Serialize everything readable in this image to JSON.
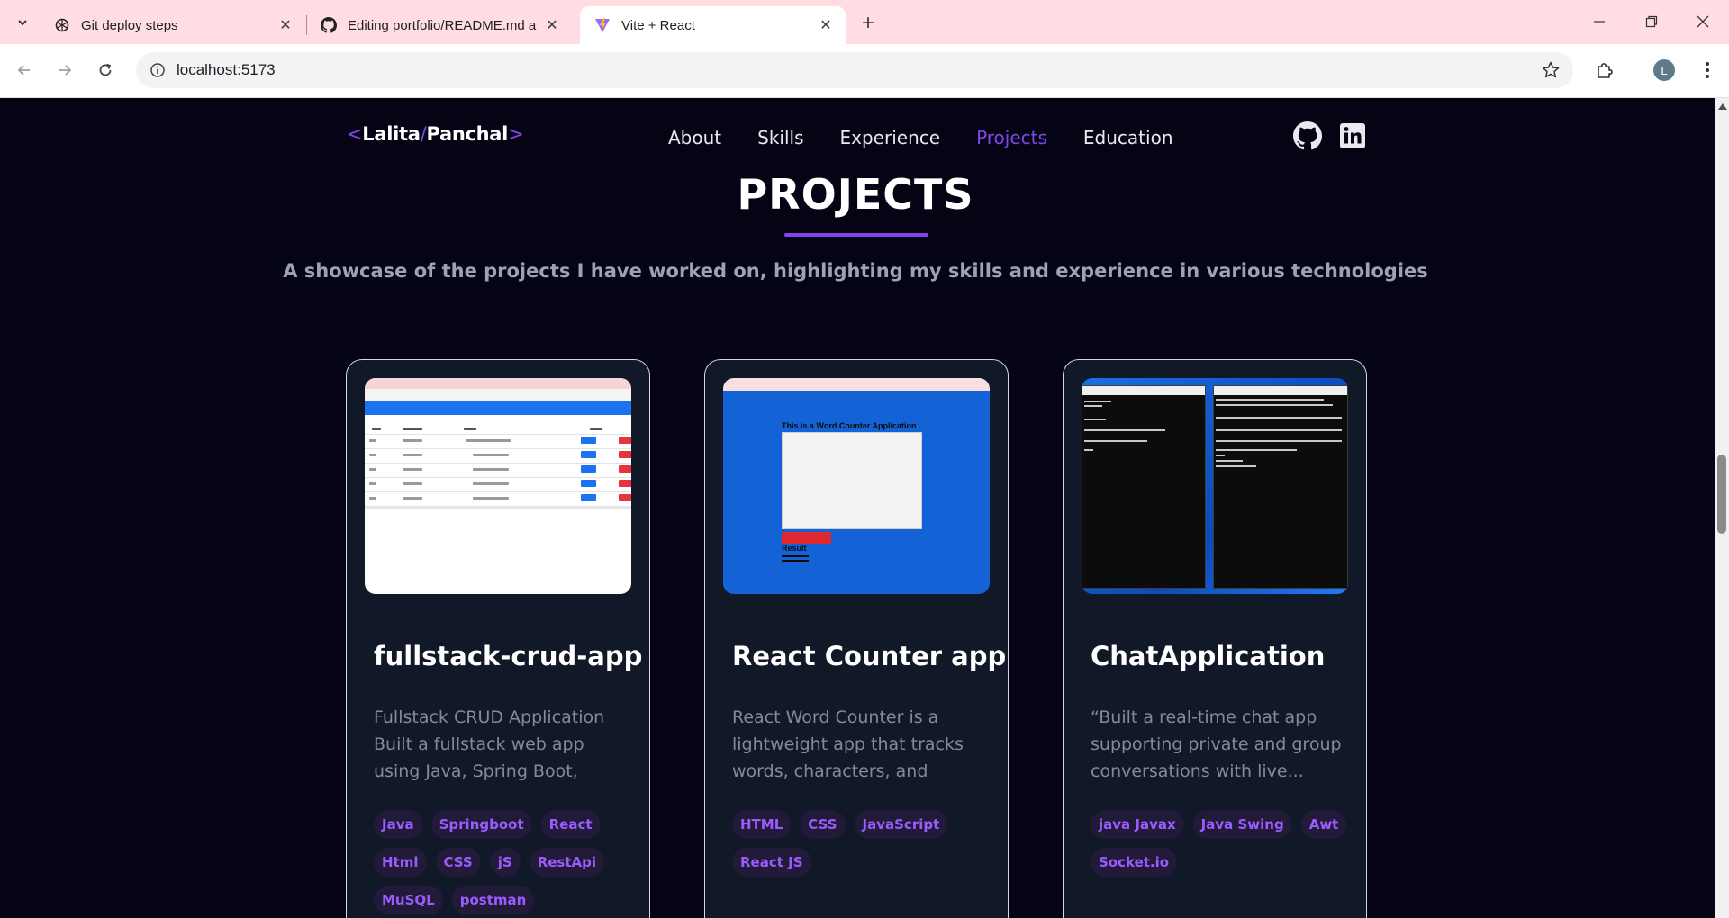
{
  "browser": {
    "tabs": [
      {
        "title": "Git deploy steps",
        "icon": "openai-icon"
      },
      {
        "title": "Editing portfolio/README.md a",
        "icon": "github-icon"
      },
      {
        "title": "Vite + React",
        "icon": "vite-icon"
      }
    ],
    "url": "localhost:5173",
    "profile_initial": "L"
  },
  "site": {
    "logo": {
      "open": "<",
      "first": "Lalita",
      "slash": "/",
      "last": "Panchal",
      "close": ">"
    },
    "nav": [
      {
        "label": "About"
      },
      {
        "label": "Skills"
      },
      {
        "label": "Experience"
      },
      {
        "label": "Projects"
      },
      {
        "label": "Education"
      }
    ],
    "active_nav": "Projects"
  },
  "section": {
    "title": "PROJECTS",
    "subtitle": "A showcase of the projects I have worked on, highlighting my skills and experience in various technologies"
  },
  "projects": [
    {
      "title": "fullstack-crud-app",
      "description": "Fullstack CRUD Application Built a fullstack web app using Java, Spring Boot, React, HT...",
      "tags": [
        "Java",
        "Springboot",
        "React",
        "Html",
        "CSS",
        "jS",
        "RestApi",
        "MuSQL",
        "postman"
      ]
    },
    {
      "title": "React Counter app",
      "description": "React Word Counter is a lightweight app that tracks words, characters, and readin...",
      "tags": [
        "HTML",
        "CSS",
        "JavaScript",
        "React JS"
      ]
    },
    {
      "title": "ChatApplication",
      "description": "“Built a real-time chat app supporting private and group conversations with live...",
      "tags": [
        "java Javax",
        "Java Swing",
        "Awt",
        "Socket.io"
      ]
    }
  ],
  "wordcounter_preview": {
    "heading": "This is a Word Counter Application",
    "result": "Result"
  },
  "colors": {
    "accent": "#8245ec",
    "background": "#050414",
    "card": "#111827",
    "tab_bar": "#ffdde3"
  }
}
